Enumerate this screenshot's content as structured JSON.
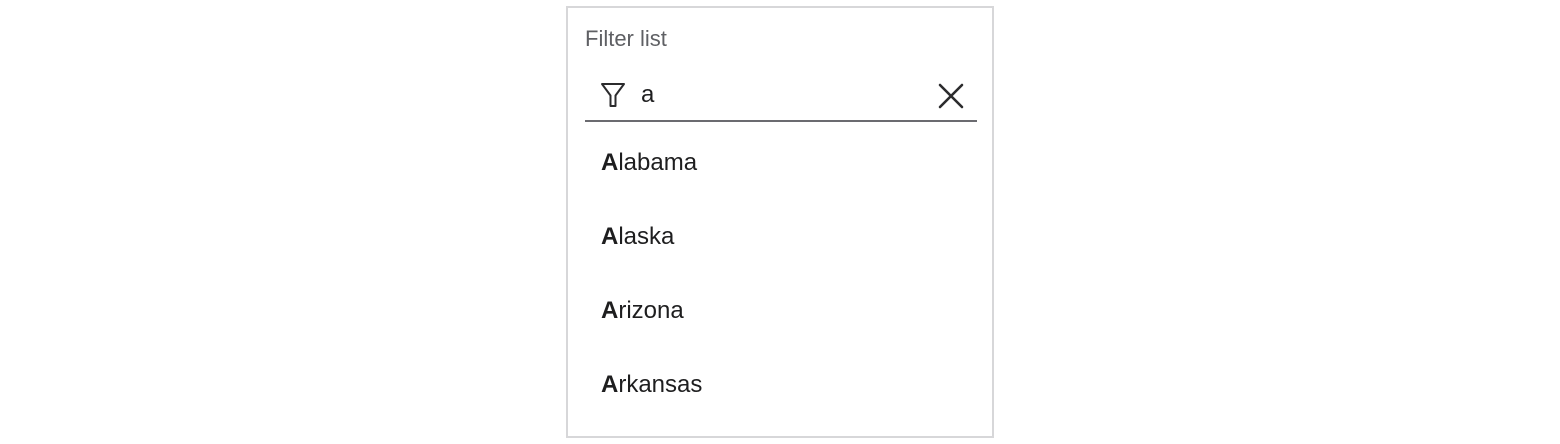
{
  "filter": {
    "label": "Filter list",
    "value": "a",
    "icon": "filter-icon",
    "clear_icon": "close-icon"
  },
  "options": [
    {
      "match": "A",
      "rest": "labama"
    },
    {
      "match": "A",
      "rest": "laska"
    },
    {
      "match": "A",
      "rest": "rizona"
    },
    {
      "match": "A",
      "rest": "rkansas"
    }
  ]
}
